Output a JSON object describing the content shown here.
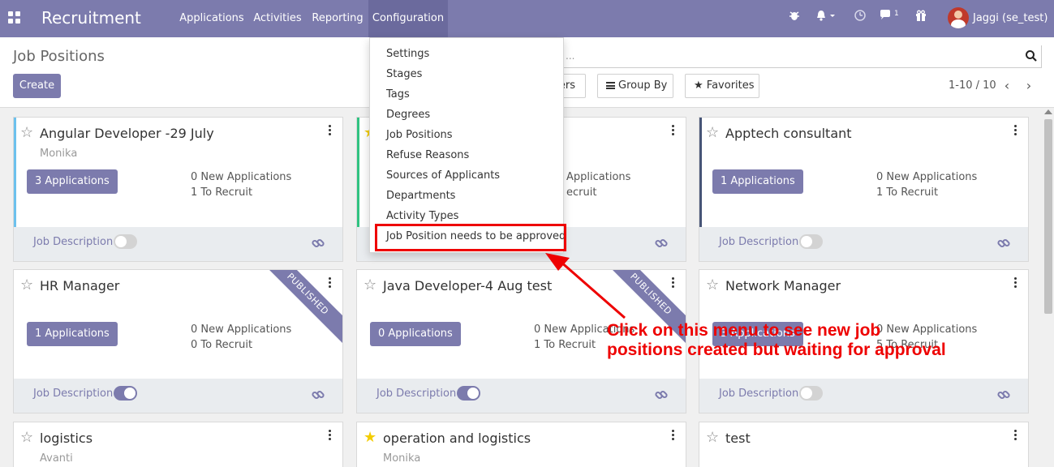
{
  "navbar": {
    "brand": "Recruitment",
    "menu": [
      "Applications",
      "Activities",
      "Reporting",
      "Configuration"
    ],
    "messages_count": "1",
    "user": "Jaggi (se_test)"
  },
  "control": {
    "page_title": "Job Positions",
    "create_label": "Create",
    "search_placeholder": "...",
    "filters_label": "ers",
    "group_by_label": "Group By",
    "favorites_label": "Favorites",
    "pager": "1-10 / 10"
  },
  "configuration_menu": {
    "items": [
      "Settings",
      "Stages",
      "Tags",
      "Degrees",
      "Job Positions",
      "Refuse Reasons",
      "Sources of Applicants",
      "Departments",
      "Activity Types",
      "Job Position needs to be approved"
    ]
  },
  "cards": [
    {
      "title": "Angular Developer -29 July",
      "company": "Monika",
      "applications": "3 Applications",
      "new_apps": "0 New Applications",
      "to_recruit": "1 To Recruit",
      "job_description": "Job Description",
      "favorite": false,
      "published": false,
      "jd_on": false,
      "color": "#6cc1ed"
    },
    {
      "title": "",
      "company": "",
      "applications": "",
      "new_apps": "Applications",
      "to_recruit": "ecruit",
      "job_description": "Job Description",
      "favorite": true,
      "published": false,
      "jd_on": false,
      "color": "#30c381"
    },
    {
      "title": "Apptech consultant",
      "company": "",
      "applications": "1 Applications",
      "new_apps": "0 New Applications",
      "to_recruit": "1 To Recruit",
      "job_description": "Job Description",
      "favorite": false,
      "published": false,
      "jd_on": false,
      "color": "#475577"
    },
    {
      "title": "HR Manager",
      "company": "",
      "applications": "1 Applications",
      "new_apps": "0 New Applications",
      "to_recruit": "0 To Recruit",
      "job_description": "Job Description",
      "favorite": false,
      "published": true,
      "jd_on": true,
      "color": ""
    },
    {
      "title": "Java Developer-4 Aug test",
      "company": "",
      "applications": "0 Applications",
      "new_apps": "0 New Applications",
      "to_recruit": "1 To Recruit",
      "job_description": "Job Description",
      "favorite": false,
      "published": true,
      "jd_on": true,
      "color": ""
    },
    {
      "title": "Network Manager",
      "company": "",
      "applications": "3 Applications",
      "new_apps": "0 New Applications",
      "to_recruit": "5 To Recruit",
      "job_description": "Job Description",
      "favorite": false,
      "published": false,
      "jd_on": false,
      "color": ""
    },
    {
      "title": "logistics",
      "company": "Avanti",
      "favorite": false
    },
    {
      "title": "operation and logistics",
      "company": "Monika",
      "favorite": true
    },
    {
      "title": "test",
      "company": "",
      "favorite": false
    }
  ],
  "ribbon_text": "PUBLISHED",
  "annotation": {
    "line1": "Click on this menu to see new job",
    "line2": "positions created but waiting for approval",
    "color": "#ee0000"
  },
  "theme": {
    "primary": "#7c7bad",
    "favorite": "#f3cc00"
  }
}
